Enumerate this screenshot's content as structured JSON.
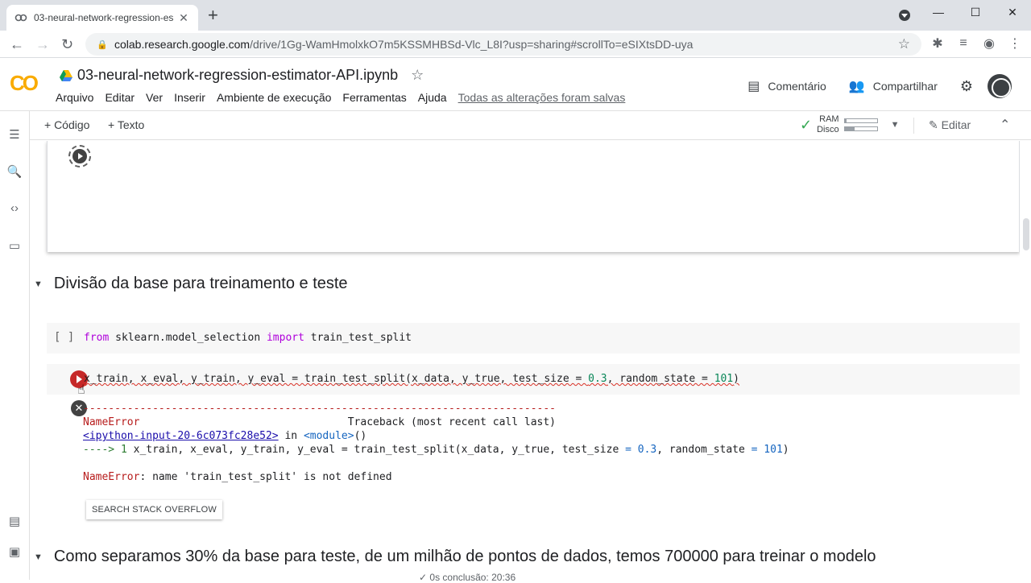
{
  "browser": {
    "tab_title": "03-neural-network-regression-es",
    "url_host": "colab.research.google.com",
    "url_path": "/drive/1Gg-WamHmolxkO7m5KSSMHBSd-Vlc_L8I?usp=sharing#scrollTo=eSIXtsDD-uya"
  },
  "colab": {
    "logo": "CO",
    "notebook_title": "03-neural-network-regression-estimator-API.ipynb",
    "menu": [
      "Arquivo",
      "Editar",
      "Ver",
      "Inserir",
      "Ambiente de execução",
      "Ferramentas",
      "Ajuda"
    ],
    "saved_status": "Todas as alterações foram salvas",
    "comment_label": "Comentário",
    "share_label": "Compartilhar"
  },
  "toolbar": {
    "add_code": "+ Código",
    "add_text": "+ Texto",
    "ram_label": "RAM",
    "disk_label": "Disco",
    "ram_usage": 0.05,
    "disk_usage": 0.3,
    "edit_label": "Editar"
  },
  "sections": [
    {
      "title": "Divisão da base para treinamento e teste"
    },
    {
      "title": "Como separamos 30% da base para teste, de um milhão de pontos de dados, temos 700000 para treinar o modelo"
    }
  ],
  "cells": {
    "import_cell": {
      "bracket": "[ ]",
      "kw_from": "from",
      "module": " sklearn.model_selection ",
      "kw_import": "import",
      "name": " train_test_split"
    },
    "split_cell": {
      "code_part1": "x_train, x_eval, y_train, y_eval = train_test_split(x_data, y_true, test_size = ",
      "num1": "0.3",
      "code_part2": ", random_state = ",
      "num2": "101",
      "code_part3": ")"
    }
  },
  "error_output": {
    "dashes": "---------------------------------------------------------------------------",
    "error_name": "NameError",
    "traceback_header": "                                 Traceback (most recent call last)",
    "input_link": "<ipython-input-20-6c073fc28e52>",
    "in_text": " in ",
    "module_text": "<module>",
    "module_paren": "()",
    "arrow": "----> 1 ",
    "line_part1": "x_train, x_eval, y_train, y_eval = train_test_split(x_data, y_true, test_size ",
    "eq1": "=",
    "num1": " 0.3",
    "line_part2": ", random_state ",
    "eq2": "=",
    "num2": " 101",
    "line_part3": ")",
    "message_name": "NameError",
    "message_text": ": name 'train_test_split' is not defined",
    "search_button": "SEARCH STACK OVERFLOW"
  },
  "status": {
    "text": "✓ 0s   conclusão: 20:36"
  }
}
